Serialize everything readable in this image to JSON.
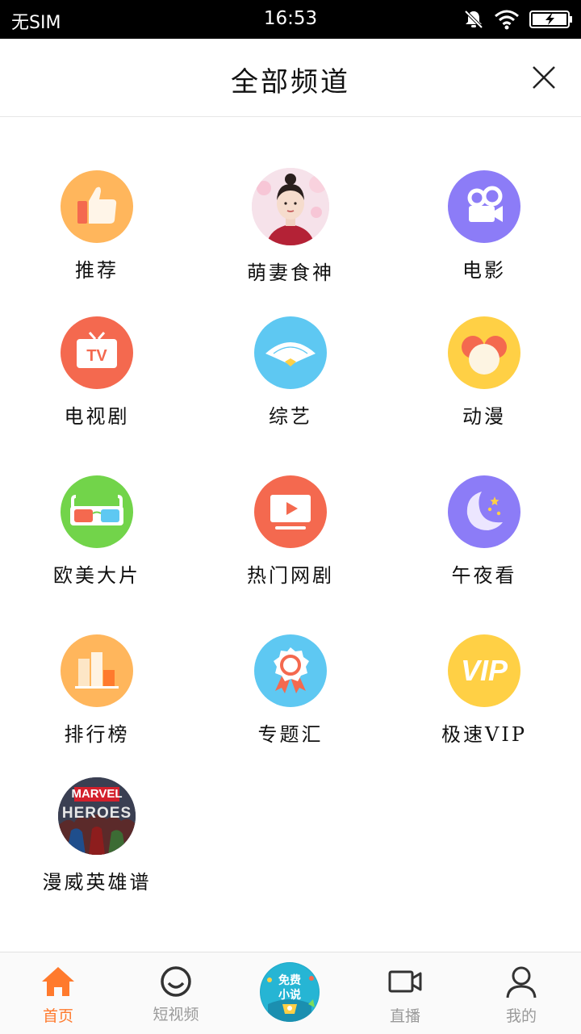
{
  "status_bar": {
    "carrier": "无SIM",
    "time": "16:53"
  },
  "header": {
    "title": "全部频道"
  },
  "channels": [
    {
      "label": "推荐",
      "icon": "thumbs-up-icon",
      "color": "#ffb65c"
    },
    {
      "label": "萌妻食神",
      "icon": "drama-poster-icon",
      "color": "#e8cfd8"
    },
    {
      "label": "电影",
      "icon": "movie-camera-icon",
      "color": "#8c7cf7"
    },
    {
      "label": "电视剧",
      "icon": "tv-icon",
      "color": "#f4694f"
    },
    {
      "label": "综艺",
      "icon": "fan-icon",
      "color": "#5ec8f2"
    },
    {
      "label": "动漫",
      "icon": "mouse-ears-icon",
      "color": "#ffd045"
    },
    {
      "label": "欧美大片",
      "icon": "3d-glasses-icon",
      "color": "#72d44a"
    },
    {
      "label": "热门网剧",
      "icon": "play-screen-icon",
      "color": "#f4694f"
    },
    {
      "label": "午夜看",
      "icon": "moon-stars-icon",
      "color": "#8c7cf7"
    },
    {
      "label": "排行榜",
      "icon": "bar-chart-icon",
      "color": "#ffb65c"
    },
    {
      "label": "专题汇",
      "icon": "award-ribbon-icon",
      "color": "#5ec8f2"
    },
    {
      "label": "极速VIP",
      "icon": "vip-icon",
      "color": "#ffd045"
    },
    {
      "label": "漫威英雄谱",
      "icon": "marvel-heroes-poster-icon",
      "color": "#2c3448"
    }
  ],
  "vip_icon_text": "VIP",
  "marvel_poster_text": {
    "top": "MARVEL",
    "bottom": "HEROES"
  },
  "tabbar": {
    "tabs": [
      {
        "label": "首页",
        "icon": "home-icon",
        "active": true
      },
      {
        "label": "短视频",
        "icon": "short-video-icon",
        "active": false
      },
      {
        "label": "",
        "icon": "free-novel-icon",
        "active": false
      },
      {
        "label": "直播",
        "icon": "live-camera-icon",
        "active": false
      },
      {
        "label": "我的",
        "icon": "profile-icon",
        "active": false
      }
    ],
    "novel_badge_line1": "免费",
    "novel_badge_line2": "小说"
  },
  "colors": {
    "accent": "#ff7a2d",
    "inactive_tab": "#9a9a9a"
  }
}
